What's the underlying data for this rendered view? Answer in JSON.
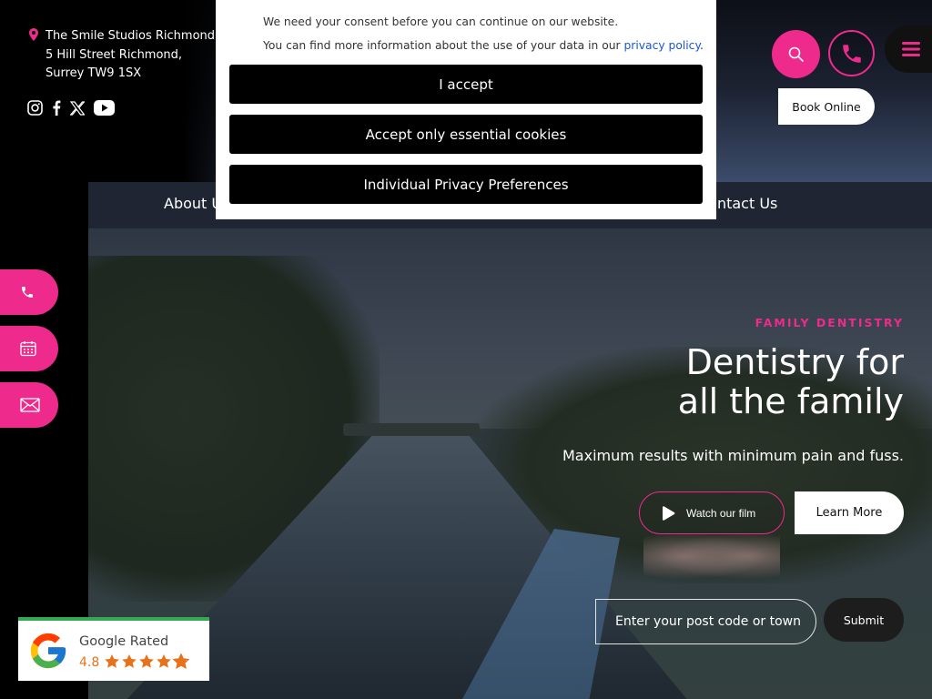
{
  "practice": {
    "address_lines": [
      "The Smile Studios Richmond",
      "5 Hill Street Richmond,",
      "Surrey TW9 1SX"
    ]
  },
  "social_icons": [
    "instagram-icon",
    "facebook-icon",
    "x-twitter-icon",
    "youtube-icon"
  ],
  "nav": {
    "items": [
      "About Us",
      "Contact Us"
    ]
  },
  "header_actions": {
    "book_label": "Book Online"
  },
  "consent": {
    "message_1": "We need your consent before you can continue on our website.",
    "message_2_prefix": "You can find more information about the use of your data in our ",
    "privacy_link": "privacy policy",
    "message_2_suffix": ".",
    "accept_label": "I accept",
    "essential_label": "Accept only essential cookies",
    "preferences_label": "Individual Privacy Preferences"
  },
  "hero": {
    "eyebrow": "FAMILY DENTISTRY",
    "headline_line1": "Dentistry for",
    "headline_line2": "all the family",
    "subline": "Maximum results with minimum pain and fuss.",
    "watch_label": "Watch our film",
    "learn_label": "Learn More",
    "postcode_placeholder": "Enter your post code or town",
    "submit_label": "Submit"
  },
  "google_badge": {
    "title": "Google Rated",
    "rating": "4.8",
    "stars": 4.8
  },
  "colors": {
    "accent": "#ee2a8c",
    "google_green": "#34a853",
    "star_orange": "#e8711c",
    "link_blue": "#1a58c9"
  }
}
